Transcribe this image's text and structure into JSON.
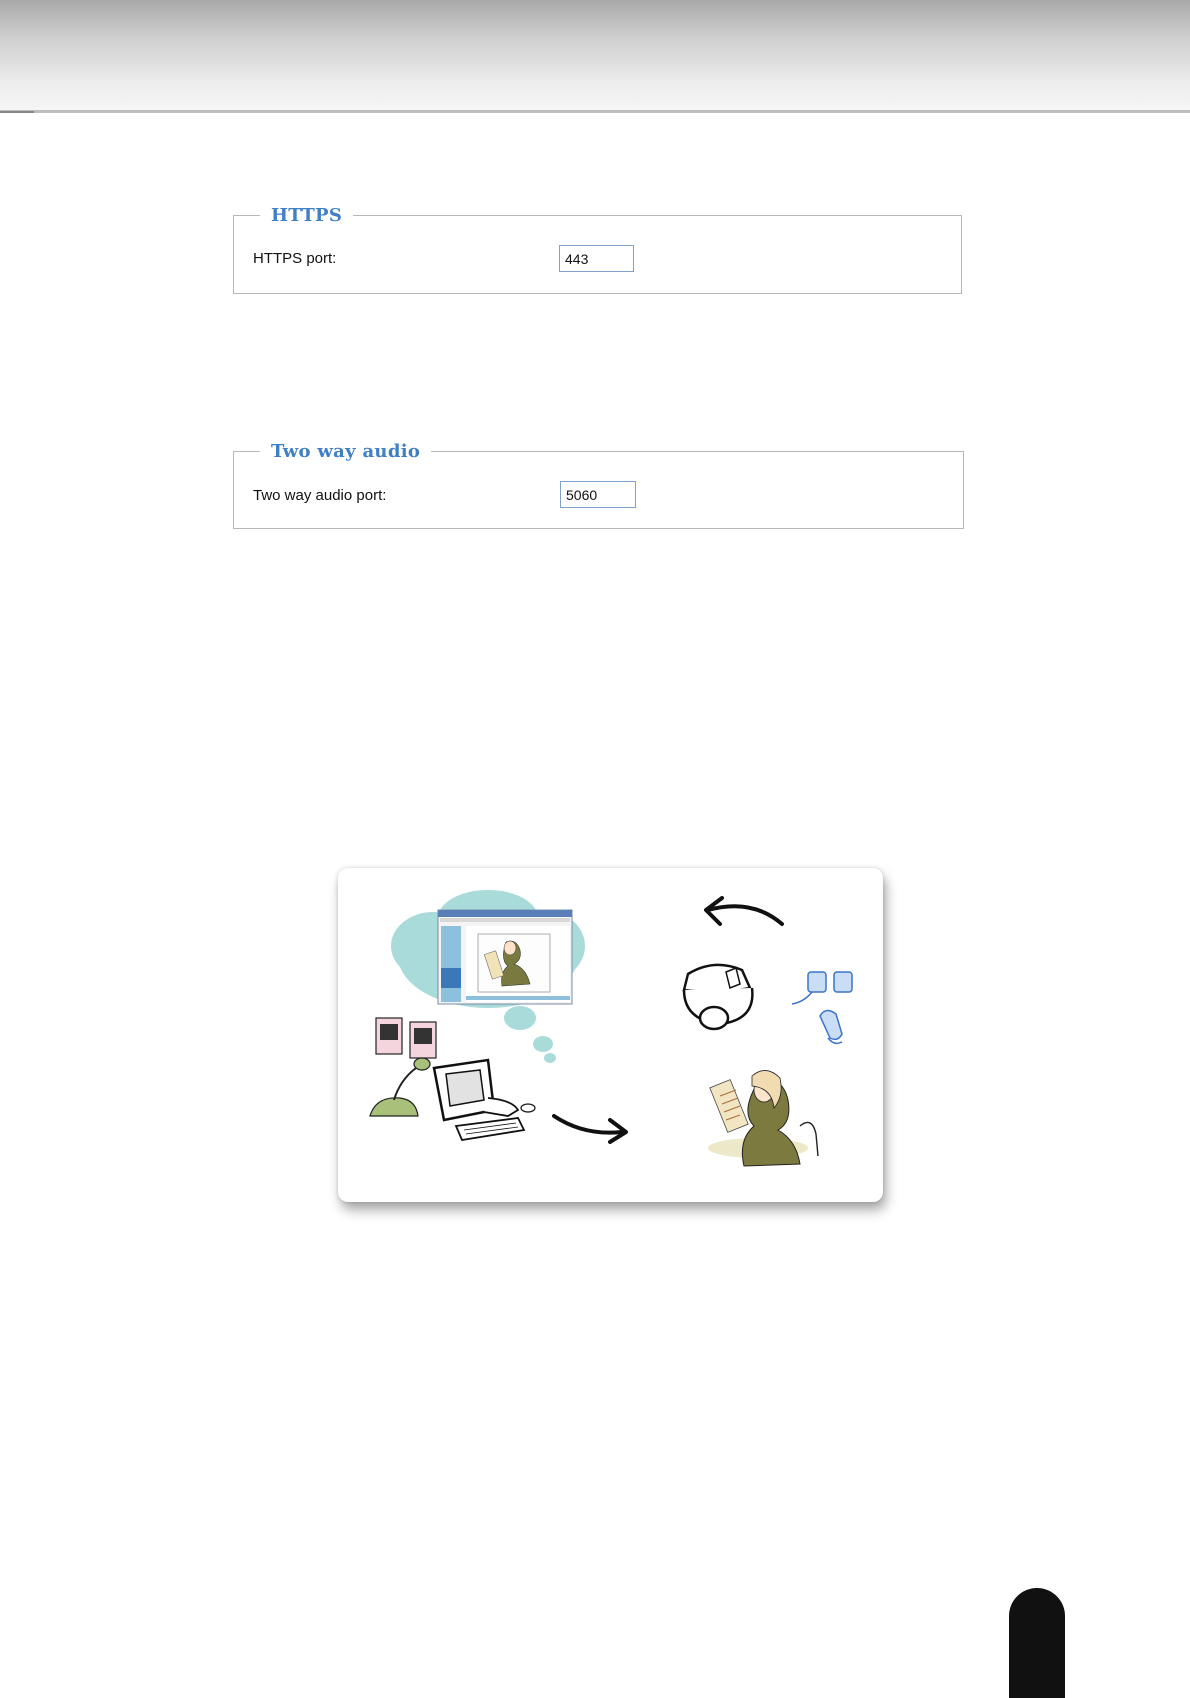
{
  "https_section": {
    "legend": "HTTPS",
    "port_label": "HTTPS port:",
    "port_value": "443"
  },
  "audio_section": {
    "legend": "Two way audio",
    "port_label": "Two way audio port:",
    "port_value": "5060"
  },
  "colors": {
    "legend_blue": "#3f7fc4",
    "input_border": "#7fa3cc",
    "page_tab": "#111111"
  },
  "illustration": {
    "icons": [
      "thought-cloud-icon",
      "browser-window-icon",
      "speakers-icon",
      "microphone-icon",
      "computer-icon",
      "dome-camera-icon",
      "speaker-phone-icon",
      "woman-reading-icon",
      "arrow-left-icon",
      "arrow-right-icon"
    ]
  }
}
